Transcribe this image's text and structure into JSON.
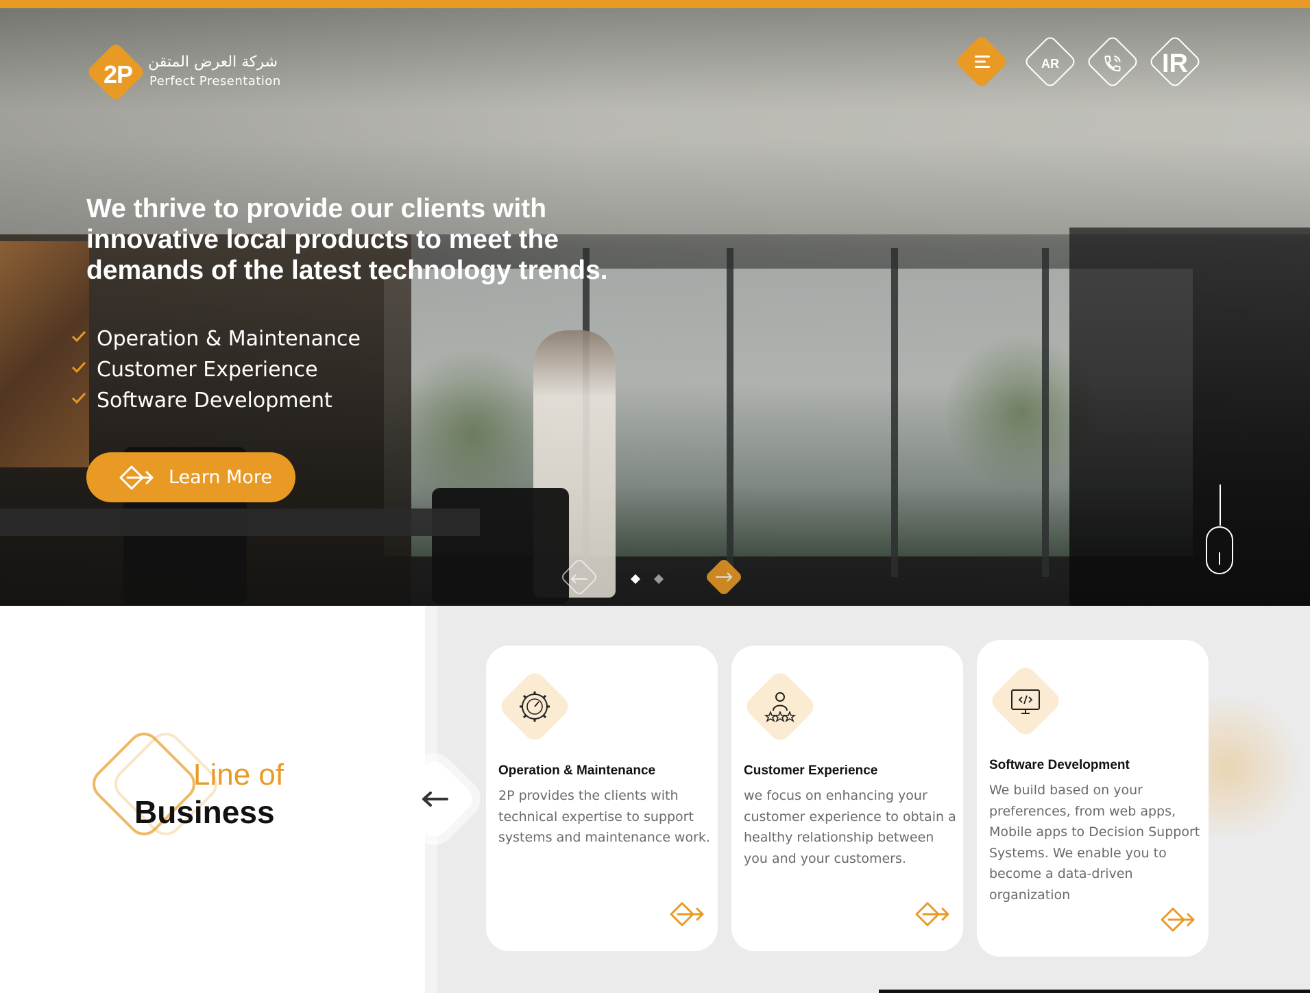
{
  "brand": {
    "logo_mark": "2P",
    "name_ar": "شركة العرض المتقن",
    "name_en": "Perfect Presentation",
    "accent_color": "#e99a24"
  },
  "nav": {
    "menu_icon": "hamburger-menu-icon",
    "lang_label": "AR",
    "phone_icon": "phone-icon",
    "ir_label": "IR"
  },
  "hero": {
    "headline": "We thrive to provide our clients with innovative local products to meet the demands of the latest technology trends.",
    "checklist": [
      "Operation & Maintenance",
      "Customer Experience",
      "Software Development"
    ],
    "cta_label": "Learn More"
  },
  "slider": {
    "total_slides": 2,
    "active_slide": 1
  },
  "line_of_business": {
    "title_line1": "Line of",
    "title_line2": "Business",
    "cards": [
      {
        "icon": "gear-speedometer-icon",
        "title": "Operation & Maintenance",
        "text": "2P provides the clients with technical expertise to support systems and maintenance work."
      },
      {
        "icon": "person-rating-stars-icon",
        "title": "Customer Experience",
        "text": "we focus on enhancing your customer experience to obtain a healthy relationship between you and your customers."
      },
      {
        "icon": "code-monitor-icon",
        "title": "Software Development",
        "text": "We build based on your preferences, from web apps, Mobile apps to Decision Support Systems. We enable you to become a data-driven organization"
      }
    ]
  }
}
